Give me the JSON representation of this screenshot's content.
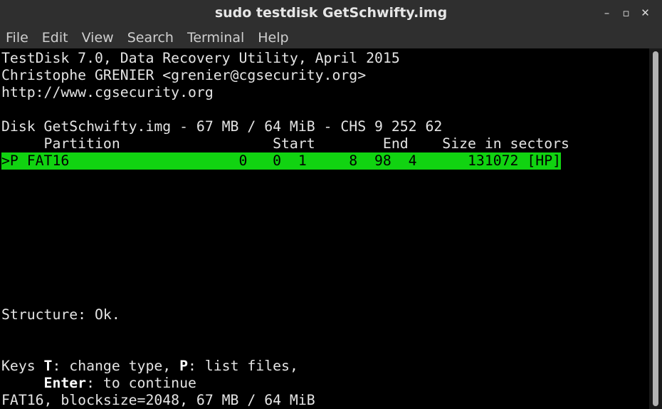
{
  "window": {
    "title": "sudo testdisk GetSchwifty.img",
    "controls": {
      "minimize": "–",
      "maximize": "▫",
      "close": "✕"
    }
  },
  "menu": [
    "File",
    "Edit",
    "View",
    "Search",
    "Terminal",
    "Help"
  ],
  "terminal": {
    "header1": "TestDisk 7.0, Data Recovery Utility, April 2015",
    "header2": "Christophe GRENIER <grenier@cgsecurity.org>",
    "header3": "http://www.cgsecurity.org",
    "disk_line": "Disk GetSchwifty.img - 67 MB / 64 MiB - CHS 9 252 62",
    "col_header": "     Partition                  Start        End    Size in sectors",
    "partition_row": ">P FAT16                    0   0  1     8  98  4      131072 [HP]",
    "structure": "Structure: Ok.",
    "keys_prefix": "Keys ",
    "keys_t": "T",
    "keys_mid": ": change type, ",
    "keys_p": "P",
    "keys_suffix": ": list files,",
    "enter_indent": "     ",
    "enter_key": "Enter",
    "enter_suffix": ": to continue",
    "fs_info": "FAT16, blocksize=2048, 67 MB / 64 MiB"
  },
  "colors": {
    "selection": "#11d311",
    "chrome": "#2f2f2f"
  }
}
